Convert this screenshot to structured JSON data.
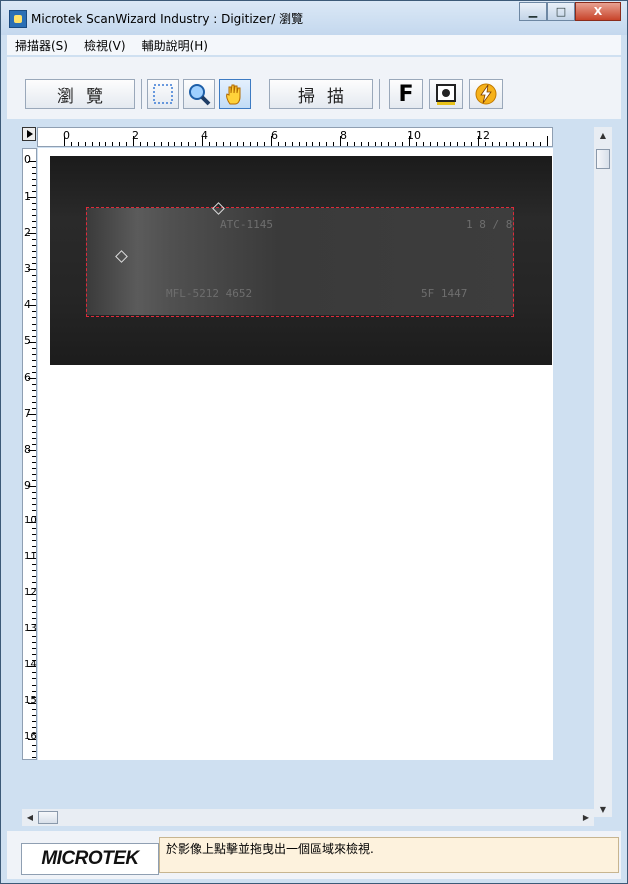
{
  "window": {
    "title": "Microtek ScanWizard Industry : Digitizer/ 瀏覽"
  },
  "caption": {
    "minimize": "▁",
    "maximize": "□",
    "close": "X"
  },
  "menu": [
    "掃描器(S)",
    "檢視(V)",
    "輔助說明(H)"
  ],
  "toolbar": {
    "preview_label": "瀏覽",
    "scan_label": "掃描",
    "f_label": "F",
    "icons": [
      "marquee-icon",
      "zoom-icon",
      "hand-icon",
      "gear-icon",
      "lightning-icon"
    ]
  },
  "ruler": {
    "horizontal": [
      "0",
      "2",
      "4",
      "6",
      "8",
      "10",
      "12"
    ],
    "vertical": [
      "0",
      "1",
      "2",
      "3",
      "4",
      "5",
      "6",
      "7",
      "8",
      "9",
      "10",
      "11",
      "12",
      "13",
      "14",
      "15",
      "16"
    ]
  },
  "preview": {
    "film_labels": [
      "ATC-1145",
      "1 8 / 8",
      "MFL-5212 4652",
      "5F 1447"
    ]
  },
  "status": {
    "logo_text": "MICROTEK",
    "message": "於影像上點擊並拖曳出一個區域來檢視."
  },
  "colors": {
    "selection": "#e02a3a",
    "accent": "#c8102e"
  }
}
